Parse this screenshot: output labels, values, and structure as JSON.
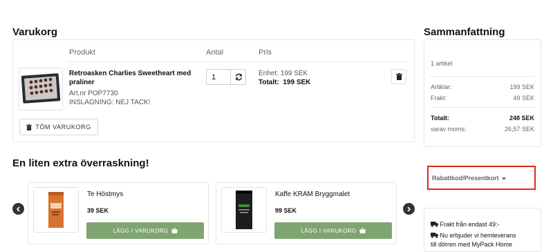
{
  "cart": {
    "title": "Varukorg",
    "columns": {
      "product": "Produkt",
      "quantity": "Antal",
      "price": "Pris"
    },
    "item": {
      "name": "Retroasken Charlies Sweetheart med praliner",
      "article": "Art.nr  POP7730",
      "wrapping": "INSLAGNING: NEJ TACK!",
      "quantity": "1",
      "unit_price": "Enhet:  199 SEK",
      "total_label": "Totalt:",
      "total_value": "199 SEK"
    },
    "empty_label": "TÖM VARUKORG"
  },
  "summary": {
    "title": "Sammanfattning",
    "count": "1 artikel",
    "articles_label": "Artiklar:",
    "articles_value": "199 SEK",
    "shipping_label": "Frakt:",
    "shipping_value": "49 SEK",
    "total_label": "Totalt:",
    "total_value": "248 SEK",
    "vat_label": "varav moms:",
    "vat_value": "26,57 SEK"
  },
  "discount": {
    "label": "Rabattkod/Presentkort"
  },
  "extra": {
    "title": "En liten extra överraskning!",
    "items": [
      {
        "name": "Te Höstmys",
        "price": "39 SEK",
        "button": "LÄGG I VARUKORG"
      },
      {
        "name": "Kaffe KRAM Bryggmalet",
        "price": "99 SEK",
        "button": "LÄGG I VARUKORG"
      }
    ]
  },
  "info": {
    "line1": "Frakt från endast 49:-",
    "line2": "Nu erbjuder vi hemleverans",
    "line3": "till dörren med MyPack Home"
  },
  "colors": {
    "accent_green": "#7fa570",
    "highlight_red": "#e0261c"
  }
}
